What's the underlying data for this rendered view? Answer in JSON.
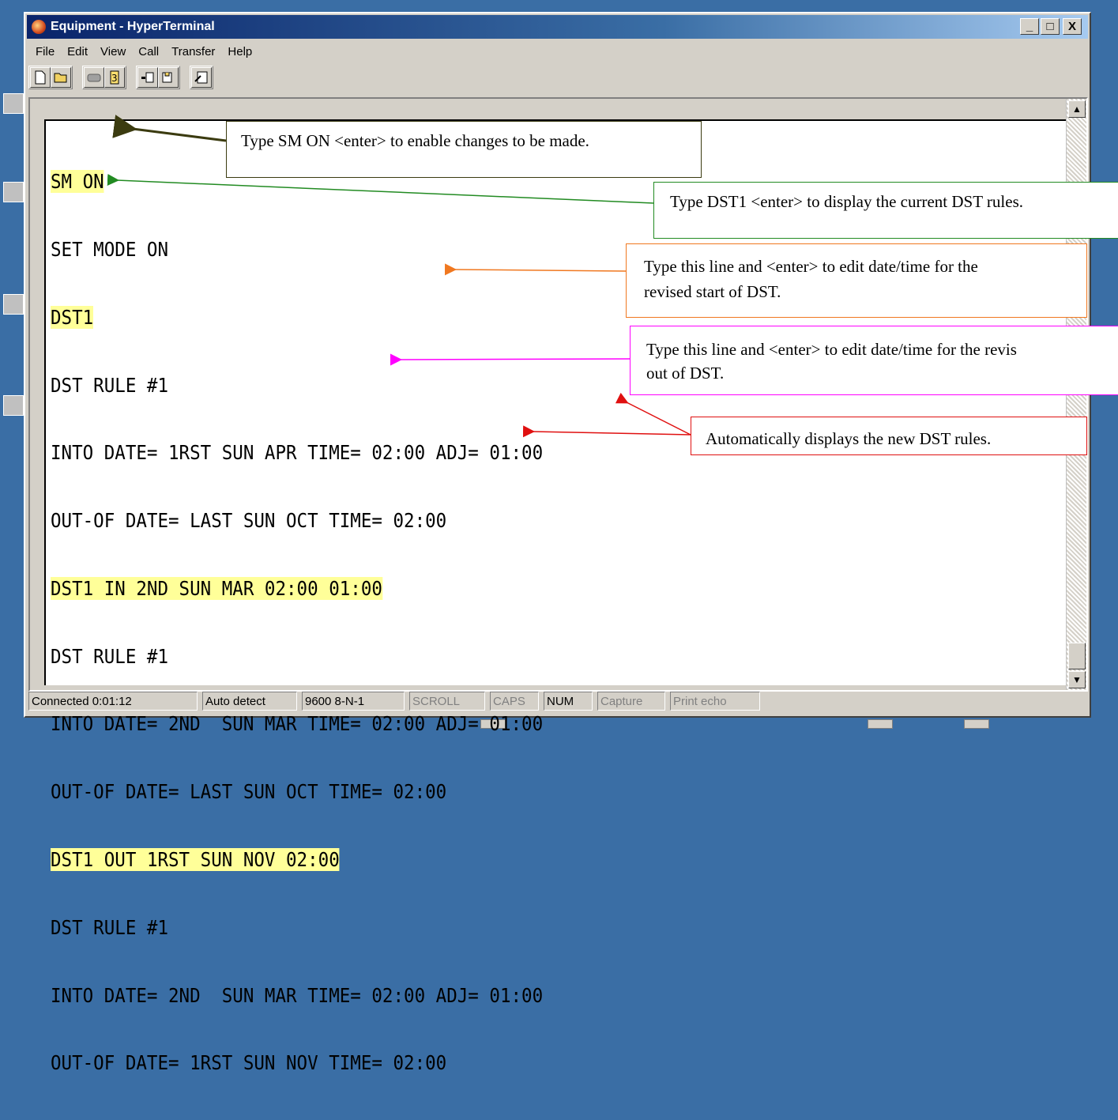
{
  "window": {
    "title": "Equipment - HyperTerminal",
    "controls": {
      "minimize": "_",
      "maximize": "□",
      "close": "X"
    }
  },
  "menu": [
    "File",
    "Edit",
    "View",
    "Call",
    "Transfer",
    "Help"
  ],
  "toolbar": {
    "icons": [
      "new-icon",
      "open-icon",
      "connect-icon",
      "disconnect-icon",
      "send-icon",
      "receive-icon",
      "properties-icon"
    ]
  },
  "terminal": {
    "lines": [
      "SM ON",
      "SET MODE ON",
      "DST1",
      "DST RULE #1",
      "INTO DATE= 1RST SUN APR TIME= 02:00 ADJ= 01:00",
      "OUT-OF DATE= LAST SUN OCT TIME= 02:00",
      "DST1 IN 2ND SUN MAR 02:00 01:00",
      "DST RULE #1",
      "INTO DATE= 2ND  SUN MAR TIME= 02:00 ADJ= 01:00",
      "OUT-OF DATE= LAST SUN OCT TIME= 02:00",
      "DST1 OUT 1RST SUN NOV 02:00",
      "DST RULE #1",
      "INTO DATE= 2ND  SUN MAR TIME= 02:00 ADJ= 01:00",
      "OUT-OF DATE= 1RST SUN NOV TIME= 02:00"
    ]
  },
  "status": {
    "connected": "Connected 0:01:12",
    "detect": "Auto detect",
    "port": "9600 8-N-1",
    "scroll": "SCROLL",
    "caps": "CAPS",
    "num": "NUM",
    "capture": "Capture",
    "print_echo": "Print echo"
  },
  "callouts": {
    "sm_on": "Type SM ON <enter> to enable changes to be made.",
    "dst1": "Type DST1 <enter> to display the current DST rules.",
    "dst_in_1": "Type this line and <enter> to edit date/time for the",
    "dst_in_2": "revised start of DST.",
    "dst_out_1": "Type this line and <enter> to edit date/time for the revis",
    "dst_out_2": "out of DST.",
    "auto": "Automatically displays the new DST rules."
  },
  "colors": {
    "highlight": "#ffff99",
    "sm_on_arrow": "#3b3b10",
    "dst1_arrow": "#228b22",
    "dst_in_arrow": "#f07820",
    "dst_out_arrow": "#ff00ff",
    "auto_arrow": "#e01010"
  }
}
